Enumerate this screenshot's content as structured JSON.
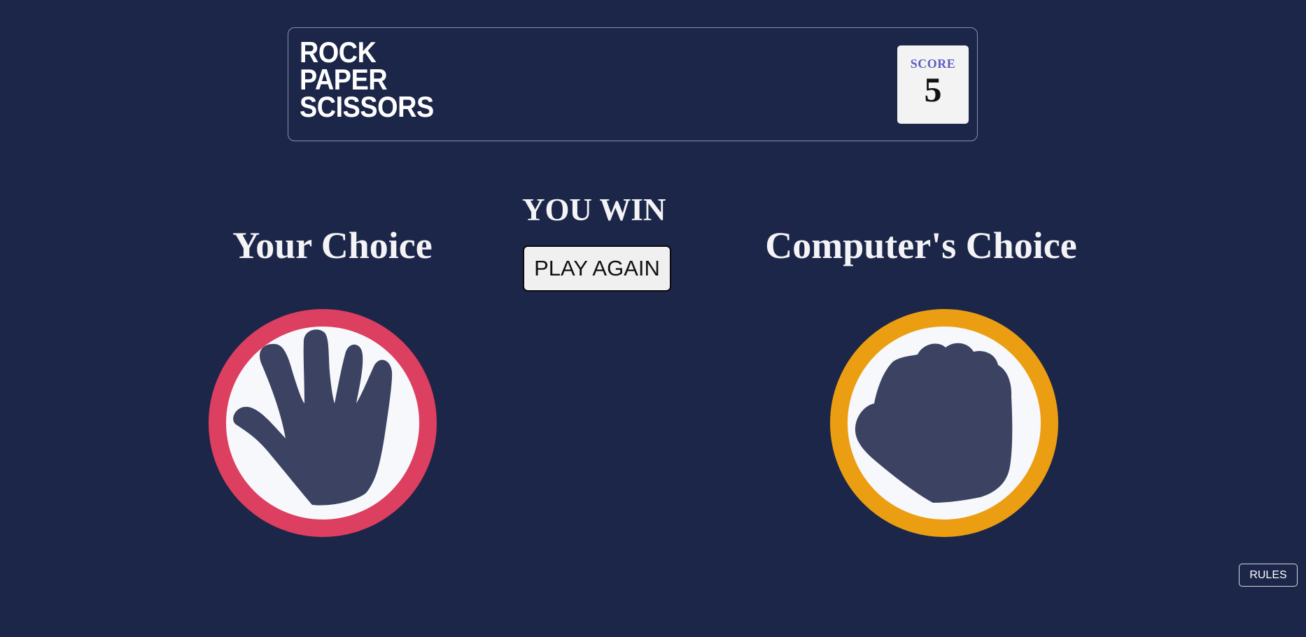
{
  "header": {
    "title_lines": [
      "ROCK",
      "PAPER",
      "SCISSORS"
    ],
    "score_label": "SCORE",
    "score_value": "5"
  },
  "result": {
    "text": "YOU WIN",
    "play_again_label": "PLAY AGAIN"
  },
  "player": {
    "heading": "Your Choice",
    "choice": "paper",
    "icon": "paper-hand-icon",
    "ring_color": "#dc3f5f"
  },
  "computer": {
    "heading": "Computer's Choice",
    "choice": "rock",
    "icon": "rock-fist-icon",
    "ring_color": "#eb9e12"
  },
  "footer": {
    "rules_label": "RULES"
  },
  "colors": {
    "background": "#1c2649",
    "hand": "#3c4262",
    "score_label": "#5e5cc0"
  }
}
